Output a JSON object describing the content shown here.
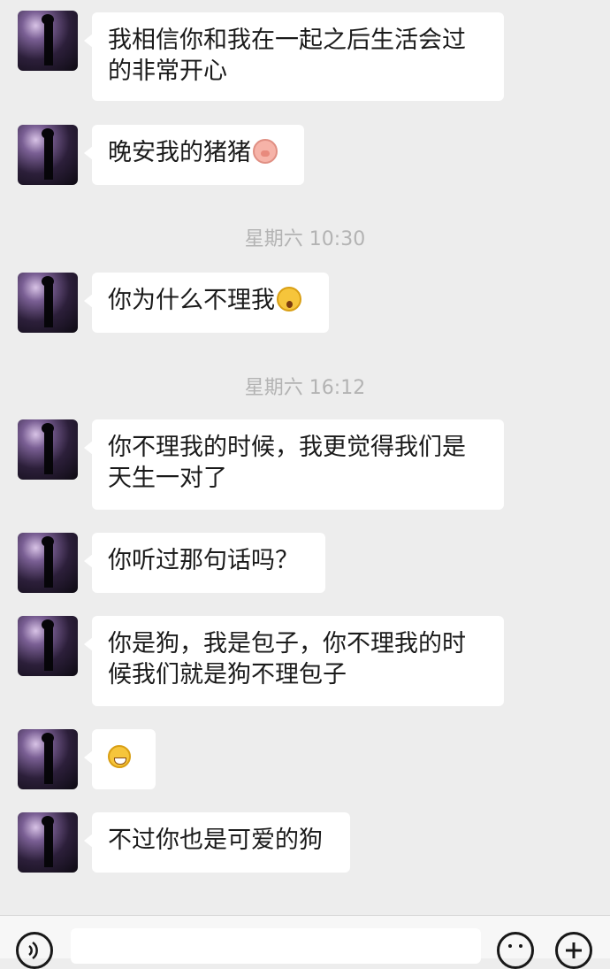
{
  "messages": [
    {
      "line1": "我相信你和我在一起之后生活会过",
      "line2": "的非常开心"
    },
    {
      "text": "晚安我的猪猪",
      "emoji": "pig-face"
    },
    {
      "time": "星期六 10:30"
    },
    {
      "text": "你为什么不理我",
      "emoji": "shocked-face"
    },
    {
      "time": "星期六 16:12"
    },
    {
      "line1": "你不理我的时候，我更觉得我们是",
      "line2": "天生一对了"
    },
    {
      "text": "你听过那句话吗？"
    },
    {
      "line1": "你是狗，我是包子，你不理我的时",
      "line2": "候我们就是狗不理包子"
    },
    {
      "emoji": "grinning-face"
    },
    {
      "text": "不过你也是可爱的狗"
    }
  ],
  "colors": {
    "background": "#ededed",
    "bubble": "#ffffff",
    "timestamp": "#b3b3b3"
  },
  "toolbar": {
    "voice_icon": "voice-icon",
    "emoji_icon": "emoji-icon",
    "plus_icon": "plus-icon"
  }
}
